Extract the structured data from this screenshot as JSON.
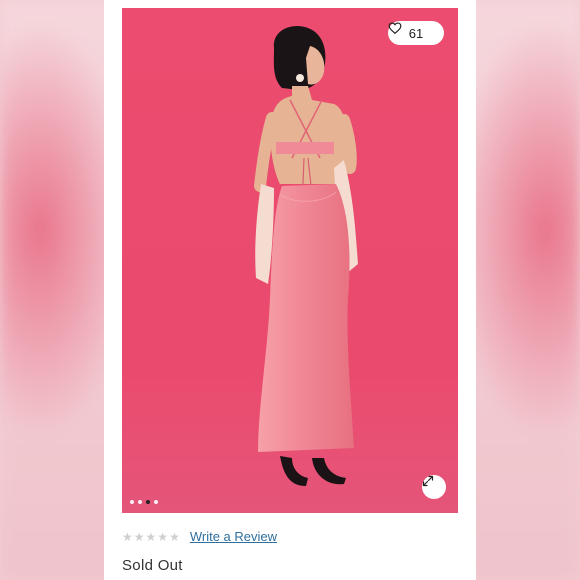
{
  "listing": {
    "like_count": "61",
    "photo_count": 4,
    "active_photo_index": 2,
    "rating": {
      "stars_filled": 0,
      "stars_total": 5,
      "write_review_label": "Write a Review"
    },
    "status_label": "Sold Out"
  },
  "colors": {
    "photo_background": "#ea4a6e",
    "dress": "#f18a96",
    "link": "#2f6f9f"
  },
  "icons": {
    "like": "heart-icon",
    "expand": "expand-icon",
    "rating": "star-icon"
  }
}
